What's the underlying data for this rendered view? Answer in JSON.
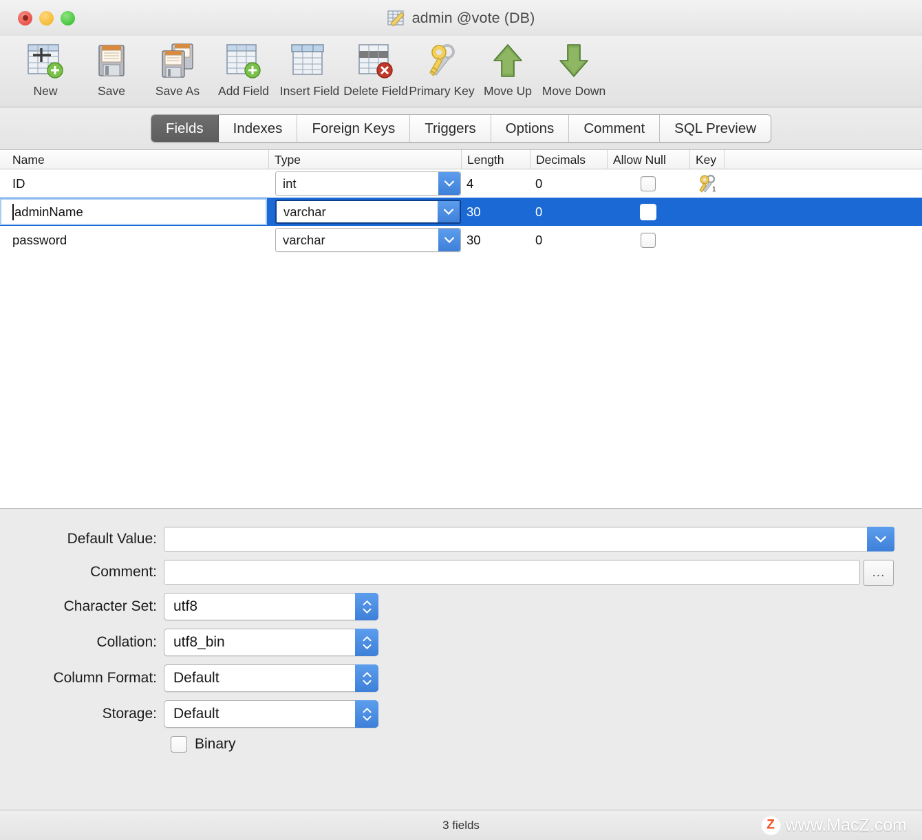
{
  "window": {
    "title": "admin @vote (DB)",
    "title_icon": "table-edit-icon",
    "traffic_lights": [
      "close-button",
      "minimize-button",
      "zoom-button"
    ]
  },
  "toolbar": {
    "items": [
      {
        "label": "New",
        "icon": "new-table-icon"
      },
      {
        "label": "Save",
        "icon": "save-floppy-icon"
      },
      {
        "label": "Save As",
        "icon": "save-as-floppy-icon"
      },
      {
        "label": "Add Field",
        "icon": "add-field-icon"
      },
      {
        "label": "Insert Field",
        "icon": "insert-field-icon"
      },
      {
        "label": "Delete Field",
        "icon": "delete-field-icon"
      },
      {
        "label": "Primary Key",
        "icon": "key-icon"
      },
      {
        "label": "Move Up",
        "icon": "arrow-up-icon"
      },
      {
        "label": "Move Down",
        "icon": "arrow-down-icon"
      }
    ]
  },
  "tabs": {
    "active": "Fields",
    "items": [
      {
        "label": "Fields"
      },
      {
        "label": "Indexes"
      },
      {
        "label": "Foreign Keys"
      },
      {
        "label": "Triggers"
      },
      {
        "label": "Options"
      },
      {
        "label": "Comment"
      },
      {
        "label": "SQL Preview"
      }
    ]
  },
  "field_table": {
    "columns": [
      "Name",
      "Type",
      "Length",
      "Decimals",
      "Allow Null",
      "Key"
    ],
    "rows": [
      {
        "name": "ID",
        "type": "int",
        "length": "4",
        "decimals": "0",
        "allow_null": false,
        "key": "primary-key-icon",
        "key_index": "1",
        "selected": false,
        "editing": false
      },
      {
        "name": "adminName",
        "type": "varchar",
        "length": "30",
        "decimals": "0",
        "allow_null": false,
        "key": "",
        "key_index": "",
        "selected": true,
        "editing": true
      },
      {
        "name": "password",
        "type": "varchar",
        "length": "30",
        "decimals": "0",
        "allow_null": false,
        "key": "",
        "key_index": "",
        "selected": false,
        "editing": false
      }
    ]
  },
  "form": {
    "default_value": {
      "label": "Default Value:",
      "value": "",
      "control": "combo-dropdown"
    },
    "comment": {
      "label": "Comment:",
      "value": "",
      "control": "text-with-ellipsis",
      "ellipsis_label": "..."
    },
    "character_set": {
      "label": "Character Set:",
      "value": "utf8"
    },
    "collation": {
      "label": "Collation:",
      "value": "utf8_bin"
    },
    "column_format": {
      "label": "Column Format:",
      "value": "Default"
    },
    "storage": {
      "label": "Storage:",
      "value": "Default"
    },
    "binary": {
      "label": "Binary",
      "checked": false
    }
  },
  "status": {
    "text": "3 fields",
    "watermark_badge": "Z",
    "watermark_text": "www.MacZ.com"
  },
  "colors": {
    "selection_blue": "#1b69d4",
    "control_blue": "#3e80d8",
    "active_tab": "#5d5d5d",
    "window_bg": "#ebebeb",
    "watermark_orange": "#f4511e"
  }
}
